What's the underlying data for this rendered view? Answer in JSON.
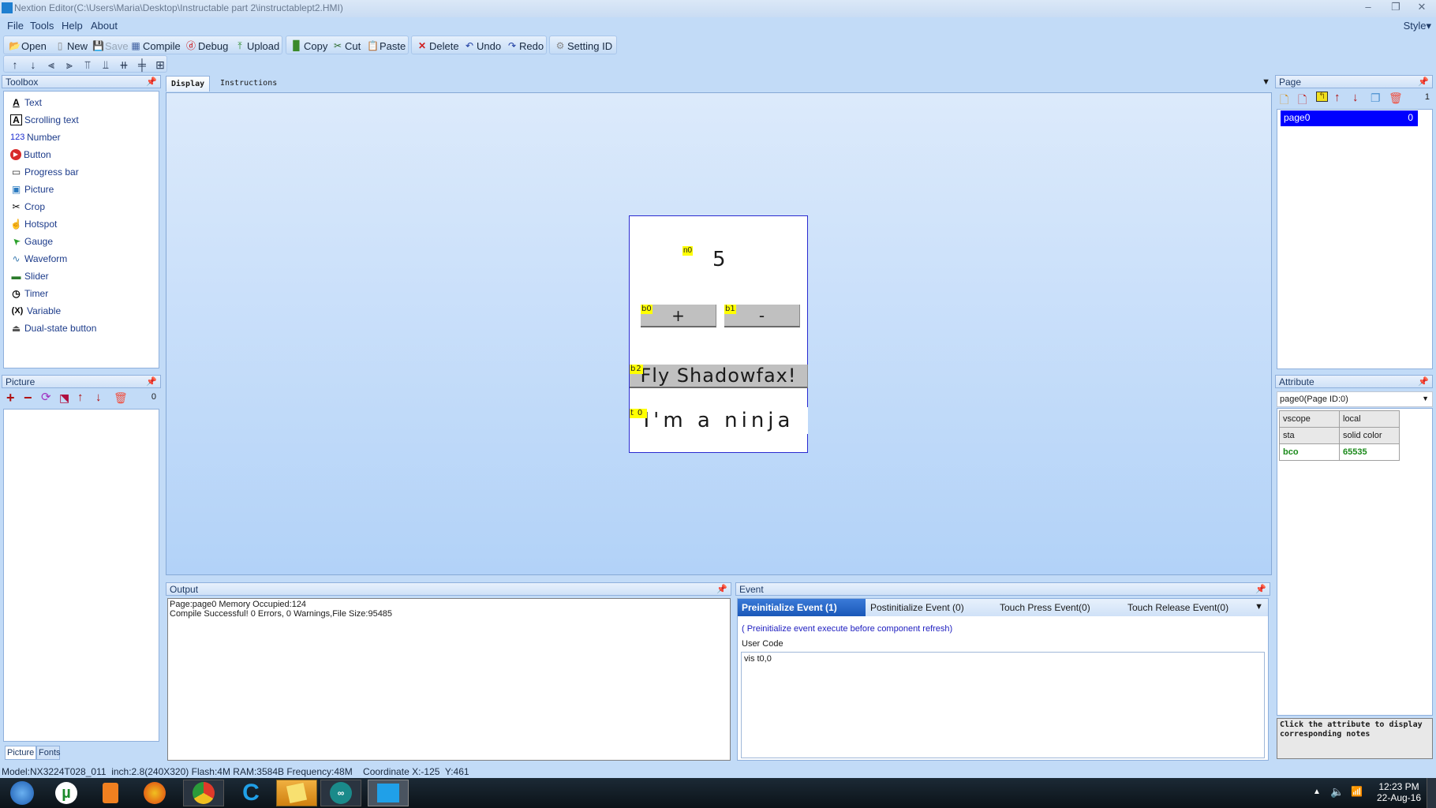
{
  "window": {
    "title": "Nextion Editor(C:\\Users\\Maria\\Desktop\\Instructable part 2\\instructablept2.HMI)",
    "controls": {
      "minimize": "–",
      "restore": "❐",
      "close": "✕"
    }
  },
  "menu": {
    "items": [
      "File",
      "Tools",
      "Help",
      "About"
    ],
    "style": "Style▾"
  },
  "toolbar": {
    "open": "Open",
    "new": "New",
    "save": "Save",
    "compile": "Compile",
    "debug": "Debug",
    "upload": "Upload",
    "copy": "Copy",
    "cut": "Cut",
    "paste": "Paste",
    "delete": "Delete",
    "undo": "Undo",
    "redo": "Redo",
    "setting_id": "Setting ID"
  },
  "align_toolbar": {
    "icons": [
      "move-up-icon",
      "move-down-icon",
      "align-left-icon",
      "align-right-icon",
      "align-top-icon",
      "align-bottom-icon",
      "center-horizontal-icon",
      "center-vertical-icon",
      "same-size-icon"
    ]
  },
  "toolbox": {
    "title": "Toolbox",
    "items": [
      {
        "label": "Text",
        "icon": "A"
      },
      {
        "label": "Scrolling text",
        "icon": "A"
      },
      {
        "label": "Number",
        "icon": "123"
      },
      {
        "label": "Button",
        "icon": "▶"
      },
      {
        "label": "Progress bar",
        "icon": "▭"
      },
      {
        "label": "Picture",
        "icon": "▣"
      },
      {
        "label": "Crop",
        "icon": "✂"
      },
      {
        "label": "Hotspot",
        "icon": "☝"
      },
      {
        "label": "Gauge",
        "icon": "➤"
      },
      {
        "label": "Waveform",
        "icon": "∿"
      },
      {
        "label": "Slider",
        "icon": "▬"
      },
      {
        "label": "Timer",
        "icon": "◷"
      },
      {
        "label": "Variable",
        "icon": "(X)"
      },
      {
        "label": "Dual-state button",
        "icon": "⏏"
      }
    ]
  },
  "picture_panel": {
    "title": "Picture",
    "count": "0",
    "tabs": [
      "Picture",
      "Fonts"
    ]
  },
  "doc_tabs": {
    "items": [
      "Display",
      "Instructions"
    ],
    "active": "Display"
  },
  "hmi_screen": {
    "components": {
      "n0": {
        "id": "n0",
        "value": "5"
      },
      "b0": {
        "id": "b0",
        "label": "+"
      },
      "b1": {
        "id": "b1",
        "label": "-"
      },
      "b2": {
        "id": "b2",
        "label": "Fly Shadowfax!"
      },
      "t0": {
        "id": "t0",
        "label": "I'm a ninja"
      }
    }
  },
  "page_panel": {
    "title": "Page",
    "count": "1",
    "pages": [
      {
        "name": "page0",
        "id": "0"
      }
    ]
  },
  "attribute_panel": {
    "title": "Attribute",
    "selected": "page0(Page ID:0)",
    "rows": [
      {
        "name": "vscope",
        "value": "local"
      },
      {
        "name": "sta",
        "value": "solid color"
      },
      {
        "name": "bco",
        "value": "65535"
      }
    ],
    "notes": "Click the attribute to display corresponding notes"
  },
  "output_panel": {
    "title": "Output",
    "lines": [
      "Page:page0 Memory Occupied:124",
      "Compile Successful! 0 Errors, 0 Warnings,File Size:95485"
    ]
  },
  "event_panel": {
    "title": "Event",
    "tabs": [
      "Preinitialize Event (1)",
      "Postinitialize Event (0)",
      "Touch Press Event(0)",
      "Touch Release Event(0)"
    ],
    "hint": "( Preinitialize event execute before component refresh)",
    "user_code_label": "User Code",
    "code": "vis t0,0"
  },
  "status_bar": {
    "text": "Model:NX3224T028_011  inch:2.8(240X320) Flash:4M RAM:3584B Frequency:48M    Coordinate X:-125  Y:461"
  },
  "taskbar": {
    "time": "12:23 PM",
    "date": "22-Aug-16"
  },
  "colors": {
    "accent": "#0000ff",
    "event_tab_active": "#2060c0",
    "attr_highlight": "#1a8a1a"
  }
}
